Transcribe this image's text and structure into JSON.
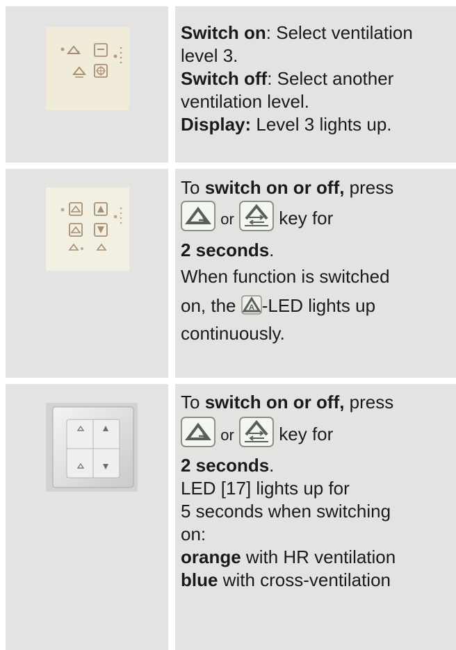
{
  "row1": {
    "l1_bold": "Switch on",
    "l1_rest": ": Select ventilation",
    "l2": "level 3.",
    "l3_bold": "Switch off",
    "l3_rest": ": Select another",
    "l4": "ventilation level.",
    "l5_bold": "Display:",
    "l5_rest": " Level 3 lights up."
  },
  "row2": {
    "l1_pre": "To ",
    "l1_bold": "switch on or off,",
    "l1_rest": " press",
    "or": "or",
    "keyfor": "key for",
    "l3_bold": "2 seconds",
    "l3_rest": ".",
    "l4": "When function is switched",
    "l5_pre": "on, the ",
    "l5_rest": "-LED lights up",
    "l6": "continuously."
  },
  "row3": {
    "l1_pre": "To ",
    "l1_bold": "switch on or off,",
    "l1_rest": " press",
    "or": "or",
    "keyfor": "key for",
    "l3_bold": "2 seconds",
    "l3_rest": ".",
    "l4": "LED [17] lights up for",
    "l5": "5 seconds when switching",
    "l6": "on:",
    "l7_bold": "orange",
    "l7_rest": " with HR ventilation",
    "l8_bold": "blue",
    "l8_rest": " with cross-ventilation"
  },
  "icons": {
    "key_humidity": "house-arrow-key-icon",
    "key_cross": "house-double-arrow-key-icon",
    "led_auto": "house-a-led-icon"
  }
}
